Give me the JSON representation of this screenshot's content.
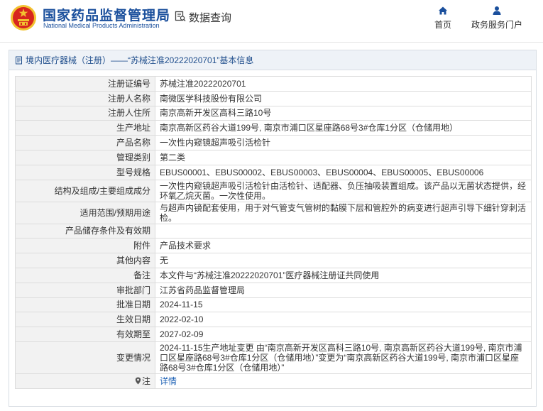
{
  "header": {
    "brand_cn": "国家药品监督管理局",
    "brand_en": "National Medical Products Administration",
    "page_heading": "数据查询",
    "nav": [
      {
        "label": "首页",
        "icon": "home-icon"
      },
      {
        "label": "政务服务门户",
        "icon": "user-icon"
      }
    ]
  },
  "panel": {
    "title": "境内医疗器械（注册）——“苏械注准20222020701”基本信息"
  },
  "rows": [
    {
      "key": "注册证编号",
      "value": "苏械注准20222020701"
    },
    {
      "key": "注册人名称",
      "value": "南微医学科技股份有限公司"
    },
    {
      "key": "注册人住所",
      "value": "南京高新开发区高科三路10号"
    },
    {
      "key": "生产地址",
      "value": "南京高新区药谷大道199号, 南京市浦口区星座路68号3#仓库1分区（仓储用地）"
    },
    {
      "key": "产品名称",
      "value": "一次性内窥镜超声吸引活检针"
    },
    {
      "key": "管理类别",
      "value": "第二类"
    },
    {
      "key": "型号规格",
      "value": "EBUS00001、EBUS00002、EBUS00003、EBUS00004、EBUS00005、EBUS00006"
    },
    {
      "key": "结构及组成/主要组成成分",
      "value": "一次性内窥镜超声吸引活检针由活检针、适配器、负压抽吸装置组成。该产品以无菌状态提供，经环氧乙烷灭菌。一次性使用。"
    },
    {
      "key": "适用范围/预期用途",
      "value": "与超声内镜配套使用，用于对气管支气管树的黏膜下层和管腔外的病变进行超声引导下细针穿刺活检。"
    },
    {
      "key": "产品储存条件及有效期",
      "value": ""
    },
    {
      "key": "附件",
      "value": "产品技术要求"
    },
    {
      "key": "其他内容",
      "value": "无"
    },
    {
      "key": "备注",
      "value": "本文件与“苏械注准20222020701”医疗器械注册证共同使用"
    },
    {
      "key": "审批部门",
      "value": "江苏省药品监督管理局"
    },
    {
      "key": "批准日期",
      "value": "2024-11-15"
    },
    {
      "key": "生效日期",
      "value": "2022-02-10"
    },
    {
      "key": "有效期至",
      "value": "2027-02-09"
    },
    {
      "key": "变更情况",
      "value": "2024-11-15生产地址变更 由“南京高新开发区高科三路10号, 南京高新区药谷大道199号, 南京市浦口区星座路68号3#仓库1分区（仓储用地）”变更为“南京高新区药谷大道199号, 南京市浦口区星座路68号3#仓库1分区（仓储用地）”"
    },
    {
      "key": "注",
      "value": "详情"
    }
  ],
  "colors": {
    "brand_blue": "#1a4f9c",
    "link_blue": "#1a5fb4",
    "emblem_red": "#d7261e",
    "emblem_gold": "#f2c230"
  }
}
